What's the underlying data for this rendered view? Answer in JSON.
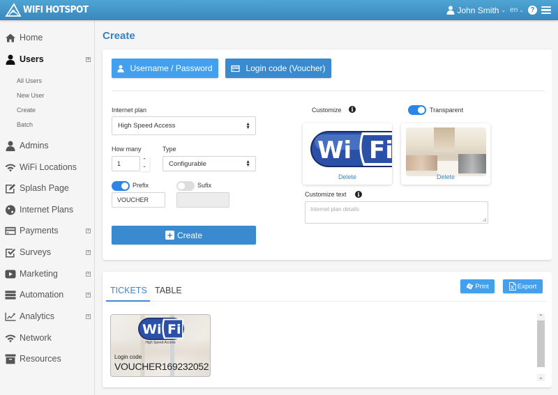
{
  "header": {
    "brand": "WIFI HOTSPOT",
    "user_name": "John Smith",
    "language": "en",
    "icons": [
      "wifi-logo-icon",
      "user-icon",
      "help-icon",
      "menu-icon"
    ]
  },
  "sidebar": {
    "items": [
      {
        "label": "Home",
        "icon": "home-icon",
        "expandable": false
      },
      {
        "label": "Users",
        "icon": "user-icon",
        "expandable": true,
        "active": true
      },
      {
        "label": "Admins",
        "icon": "user-icon",
        "expandable": false
      },
      {
        "label": "WiFi Locations",
        "icon": "wifi-icon",
        "expandable": false
      },
      {
        "label": "Splash Page",
        "icon": "edit-icon",
        "expandable": false
      },
      {
        "label": "Internet Plans",
        "icon": "globe-icon",
        "expandable": false
      },
      {
        "label": "Payments",
        "icon": "credit-card-icon",
        "expandable": true
      },
      {
        "label": "Surveys",
        "icon": "checkbox-icon",
        "expandable": true
      },
      {
        "label": "Marketing",
        "icon": "play-icon",
        "expandable": true
      },
      {
        "label": "Automation",
        "icon": "server-icon",
        "expandable": true
      },
      {
        "label": "Analytics",
        "icon": "line-chart-icon",
        "expandable": true
      },
      {
        "label": "Network",
        "icon": "wifi-icon",
        "expandable": false
      },
      {
        "label": "Resources",
        "icon": "archive-icon",
        "expandable": false
      }
    ],
    "users_submenu": [
      "All Users",
      "New User",
      "Create",
      "Batch"
    ]
  },
  "main": {
    "title": "Create",
    "mode_buttons": {
      "username_password": "Username / Password",
      "voucher": "Login code (Voucher)"
    },
    "form": {
      "internet_plan_label": "Internet plan",
      "internet_plan_value": "High Speed Access",
      "how_many_label": "How many",
      "how_many_value": "1",
      "type_label": "Type",
      "type_value": "Configurable",
      "prefix_label": "Prefix",
      "prefix_enabled": true,
      "prefix_value": "VOUCHER",
      "suffix_label": "Sufix",
      "suffix_enabled": false,
      "suffix_value": "",
      "customize_label": "Customize",
      "transparent_label": "Transparent",
      "transparent_enabled": true,
      "logo_delete": "Delete",
      "background_delete": "Delete",
      "customize_text_label": "Customize text",
      "customize_text_placeholder": "Internet plan details",
      "create_button": "Create"
    },
    "results": {
      "tabs": [
        {
          "label": "TICKETS",
          "active": true
        },
        {
          "label": "TABLE",
          "active": false
        }
      ],
      "print_button": "Print",
      "export_button": "Export",
      "ticket": {
        "logo_text": "WiFi",
        "plan": "High Speed Access",
        "code_label": "Login code",
        "code": "VOUCHER169232052"
      }
    }
  },
  "colors": {
    "header_top": "#4ea6d3",
    "header_bottom": "#3a86bd",
    "accent": "#3a8ad0",
    "button_light": "#42a0ef",
    "title": "#3d7fb9",
    "toggle_on": "#2b86e6"
  }
}
